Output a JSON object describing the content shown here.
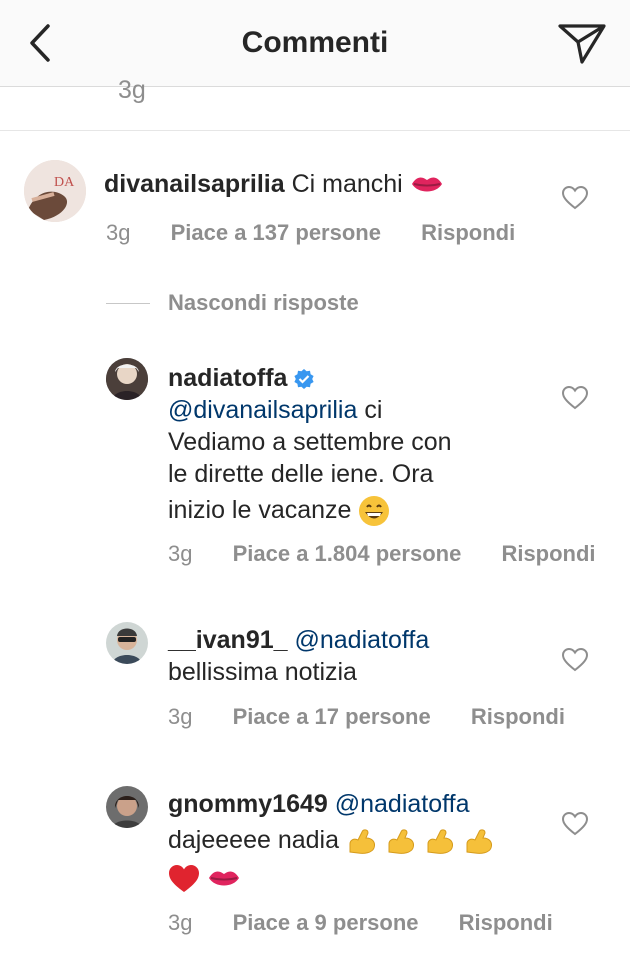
{
  "header": {
    "title": "Commenti"
  },
  "previous": {
    "time": "3g"
  },
  "comments": [
    {
      "username": "divanailsaprilia",
      "text": "Ci manchi",
      "time": "3g",
      "likes": "Piace a 137 persone",
      "reply": "Rispondi"
    }
  ],
  "hide_replies": "Nascondi risposte",
  "replies": [
    {
      "username": "nadiatoffa",
      "mention": "@divanailsaprilia",
      "line1": "ci",
      "line2": "Vediamo a settembre con",
      "line3": "le dirette delle iene. Ora",
      "line4": "inizio le vacanze",
      "time": "3g",
      "likes": "Piace a 1.804 persone",
      "reply": "Rispondi"
    },
    {
      "username": "__ivan91_",
      "mention": "@nadiatoffa",
      "line1": "bellissima notizia",
      "time": "3g",
      "likes": "Piace a 17 persone",
      "reply": "Rispondi"
    },
    {
      "username": "gnommy1649",
      "mention": "@nadiatoffa",
      "line1": "dajeeeee nadia",
      "time": "3g",
      "likes": "Piace a 9 persone",
      "reply": "Rispondi"
    }
  ],
  "colors": {
    "verified": "#3897f0",
    "mention": "#00376b",
    "meta": "#8e8e8e"
  }
}
